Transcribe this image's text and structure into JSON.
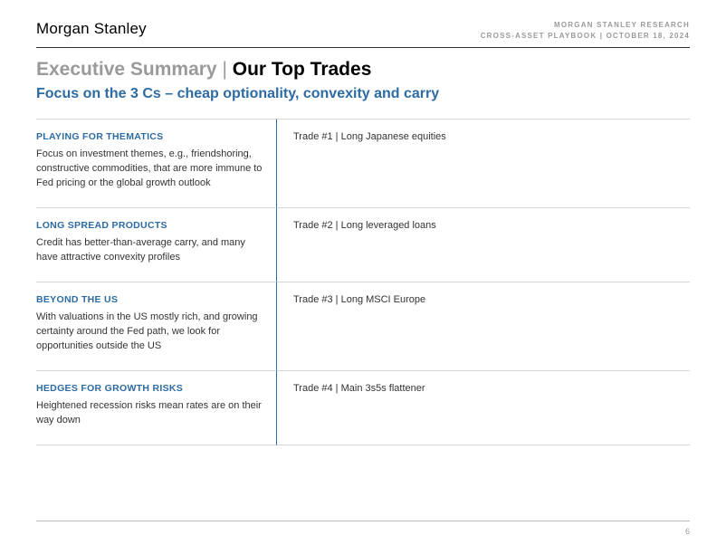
{
  "header": {
    "brand": "Morgan Stanley",
    "meta_line1": "MORGAN STANLEY RESEARCH",
    "meta_line2": "CROSS-ASSET PLAYBOOK | OCTOBER 18, 2024"
  },
  "title": {
    "prefix": "Executive Summary",
    "separator": " | ",
    "main": "Our Top Trades"
  },
  "subtitle": "Focus on the 3 Cs – cheap optionality, convexity and carry",
  "sections": [
    {
      "category": "PLAYING FOR THEMATICS",
      "description": "Focus on investment themes, e.g., friendshoring, constructive commodities, that are more immune to Fed pricing or the global growth outlook",
      "trade": "Trade #1 | Long Japanese equities"
    },
    {
      "category": "LONG SPREAD PRODUCTS",
      "description": "Credit has better-than-average carry, and many have attractive convexity profiles",
      "trade": "Trade #2 | Long leveraged loans"
    },
    {
      "category": "BEYOND THE US",
      "description": "With valuations in the US mostly rich, and growing certainty around the Fed path, we look for opportunities outside the US",
      "trade": "Trade #3 | Long MSCI Europe"
    },
    {
      "category": "HEDGES FOR GROWTH RISKS",
      "description": "Heightened recession risks mean rates are on their way down",
      "trade": "Trade #4 | Main 3s5s flattener"
    }
  ],
  "page_number": "6"
}
